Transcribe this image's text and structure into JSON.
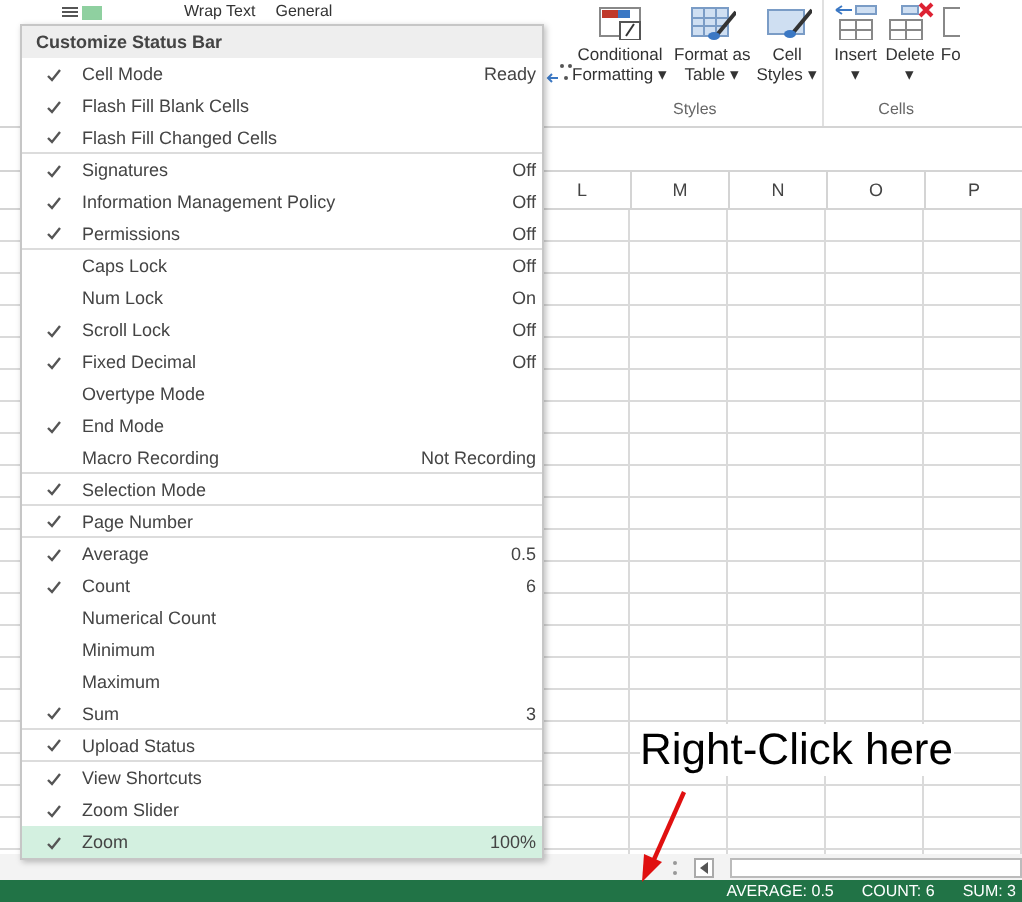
{
  "ribbon": {
    "top_labels": [
      "Wrap Text",
      "General"
    ],
    "groups": [
      {
        "label": "Styles",
        "buttons": [
          {
            "kind": "conditional",
            "lines": [
              "Conditional",
              "Formatting ▾"
            ]
          },
          {
            "kind": "table",
            "lines": [
              "Format as",
              "Table ▾"
            ]
          },
          {
            "kind": "styles",
            "lines": [
              "Cell",
              "Styles ▾"
            ]
          }
        ]
      },
      {
        "label": "Cells",
        "buttons": [
          {
            "kind": "insert",
            "lines": [
              "Insert",
              "▾"
            ]
          },
          {
            "kind": "delete",
            "lines": [
              "Delete",
              "▾"
            ]
          },
          {
            "kind": "format",
            "lines": [
              "Fo"
            ]
          }
        ]
      }
    ]
  },
  "sheet": {
    "columns": [
      "L",
      "M",
      "N",
      "O",
      "P"
    ]
  },
  "menu": {
    "title": "Customize Status Bar",
    "items": [
      {
        "label": "Cell Mode",
        "value": "Ready",
        "checked": true,
        "highlighted": false,
        "separator_after": false
      },
      {
        "label": "Flash Fill Blank Cells",
        "checked": true,
        "highlighted": false,
        "separator_after": false
      },
      {
        "label": "Flash Fill Changed Cells",
        "checked": true,
        "highlighted": false,
        "separator_after": true
      },
      {
        "label": "Signatures",
        "value": "Off",
        "checked": true,
        "highlighted": false,
        "separator_after": false
      },
      {
        "label": "Information Management Policy",
        "value": "Off",
        "checked": true,
        "highlighted": false,
        "separator_after": false
      },
      {
        "label": "Permissions",
        "value": "Off",
        "checked": true,
        "highlighted": false,
        "separator_after": true
      },
      {
        "label": "Caps Lock",
        "value": "Off",
        "checked": false,
        "highlighted": false,
        "separator_after": false
      },
      {
        "label": "Num Lock",
        "value": "On",
        "checked": false,
        "highlighted": false,
        "separator_after": false
      },
      {
        "label": "Scroll Lock",
        "value": "Off",
        "checked": true,
        "highlighted": false,
        "separator_after": false
      },
      {
        "label": "Fixed Decimal",
        "value": "Off",
        "checked": true,
        "highlighted": false,
        "separator_after": false
      },
      {
        "label": "Overtype Mode",
        "checked": false,
        "highlighted": false,
        "separator_after": false
      },
      {
        "label": "End Mode",
        "checked": true,
        "highlighted": false,
        "separator_after": false
      },
      {
        "label": "Macro Recording",
        "value": "Not Recording",
        "checked": false,
        "highlighted": false,
        "separator_after": true
      },
      {
        "label": "Selection Mode",
        "checked": true,
        "highlighted": false,
        "separator_after": true
      },
      {
        "label": "Page Number",
        "checked": true,
        "highlighted": false,
        "separator_after": true
      },
      {
        "label": "Average",
        "value": "0.5",
        "checked": true,
        "highlighted": false,
        "separator_after": false
      },
      {
        "label": "Count",
        "value": "6",
        "checked": true,
        "highlighted": false,
        "separator_after": false
      },
      {
        "label": "Numerical Count",
        "checked": false,
        "highlighted": false,
        "separator_after": false
      },
      {
        "label": "Minimum",
        "checked": false,
        "highlighted": false,
        "separator_after": false
      },
      {
        "label": "Maximum",
        "checked": false,
        "highlighted": false,
        "separator_after": false
      },
      {
        "label": "Sum",
        "value": "3",
        "checked": true,
        "highlighted": false,
        "separator_after": true
      },
      {
        "label": "Upload Status",
        "checked": true,
        "highlighted": false,
        "separator_after": true
      },
      {
        "label": "View Shortcuts",
        "checked": true,
        "highlighted": false,
        "separator_after": false
      },
      {
        "label": "Zoom Slider",
        "checked": true,
        "highlighted": false,
        "separator_after": false
      },
      {
        "label": "Zoom",
        "value": "100%",
        "checked": true,
        "highlighted": true,
        "separator_after": false
      }
    ]
  },
  "status_bar": [
    "AVERAGE: 0.5",
    "COUNT: 6",
    "SUM: 3"
  ],
  "annotation": {
    "text": "Right-Click here"
  }
}
